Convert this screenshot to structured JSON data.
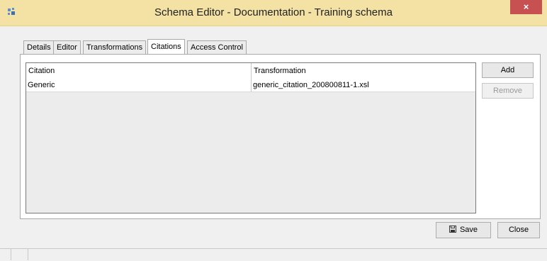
{
  "window": {
    "title": "Schema Editor - Documentation - Training schema",
    "close_glyph": "×",
    "title_bar_color": "#f3e2a4",
    "close_button_color": "#c75050"
  },
  "tabs": [
    {
      "label": "Details",
      "active": false
    },
    {
      "label": "Editor",
      "active": false
    },
    {
      "label": "Transformations",
      "active": false
    },
    {
      "label": "Citations",
      "active": true
    },
    {
      "label": "Access Control",
      "active": false
    }
  ],
  "table": {
    "columns": [
      "Citation",
      "Transformation"
    ],
    "rows": [
      [
        "Generic",
        "generic_citation_200800811-1.xsl"
      ]
    ]
  },
  "side_buttons": {
    "add_label": "Add",
    "remove_label": "Remove"
  },
  "footer_buttons": {
    "save_label": "Save",
    "close_label": "Close"
  },
  "icons": {
    "app": "app-icon",
    "save": "floppy-disk-icon"
  }
}
